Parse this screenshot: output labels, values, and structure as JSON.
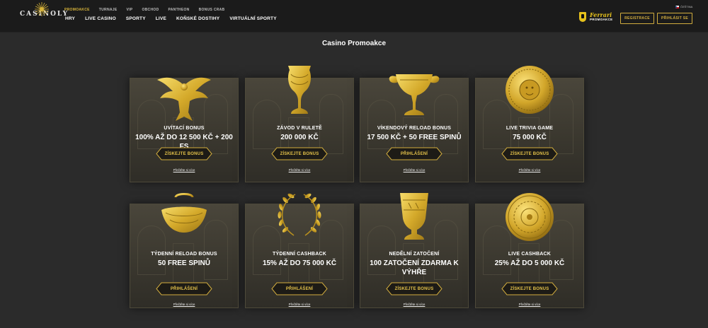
{
  "header": {
    "logo_text": "CASINOLY",
    "top_links": [
      "PROMOAKCE",
      "TURNAJE",
      "VIP",
      "OBCHOD",
      "PANTHEON",
      "BONUS CRAB"
    ],
    "main_links": [
      "HRY",
      "LIVE CASINO",
      "SPORTY",
      "LIVE",
      "KOŇSKÉ DOSTIHY",
      "VIRTUÁLNÍ SPORTY"
    ],
    "partner_word": "Ferrari",
    "partner_sub": "PROMOAKCE",
    "register_label": "REGISTRACE",
    "login_label": "PŘIHLÁSIT SE",
    "language_label": "ČEŠTINA"
  },
  "page_title": "Casino Promoakce",
  "colors": {
    "gold": "#d2ad3e",
    "background": "#2b2b2b",
    "header": "#1b1b1b"
  },
  "cards": [
    {
      "icon": "eagle-icon",
      "label": "UVÍTACÍ BONUS",
      "value": "100% AŽ DO 12 500 KČ + 200 FS",
      "button": "ZÍSKEJTE BONUS",
      "link": "Přečtěte si více"
    },
    {
      "icon": "goblet-icon",
      "label": "ZÁVOD V RULETĚ",
      "value": "200 000 KČ",
      "button": "ZÍSKEJTE BONUS",
      "link": "Přečtěte si více"
    },
    {
      "icon": "cup-icon",
      "label": "VÍKENDOVÝ RELOAD BONUS",
      "value": "17 500 KČ + 50 FREE SPINŮ",
      "button": "PŘIHLÁŠENÍ",
      "link": "Přečtěte si více"
    },
    {
      "icon": "medallion-icon",
      "label": "LIVE TRIVIA GAME",
      "value": "75 000 KČ",
      "button": "ZÍSKEJTE BONUS",
      "link": "Přečtěte si více"
    },
    {
      "icon": "vessel-icon",
      "label": "TÝDENNÍ RELOAD BONUS",
      "value": "50 FREE SPINŮ",
      "button": "PŘIHLÁŠENÍ",
      "link": "Přečtěte si více"
    },
    {
      "icon": "laurel-wreath-icon",
      "label": "TÝDENNÍ CASHBACK",
      "value": "15% AŽ DO 75 000 KČ",
      "button": "PŘIHLÁŠENÍ",
      "link": "Přečtěte si více"
    },
    {
      "icon": "krater-icon",
      "label": "NEDĚLNÍ ZATOČENÍ",
      "value": "100 ZATOČENÍ ZDARMA K VÝHŘE",
      "button": "ZÍSKEJTE BONUS",
      "link": "Přečtěte si více"
    },
    {
      "icon": "gold-coin-icon",
      "label": "LIVE CASHBACK",
      "value": "25% AŽ DO 5 000 KČ",
      "button": "ZÍSKEJTE BONUS",
      "link": "Přečtěte si více"
    }
  ]
}
